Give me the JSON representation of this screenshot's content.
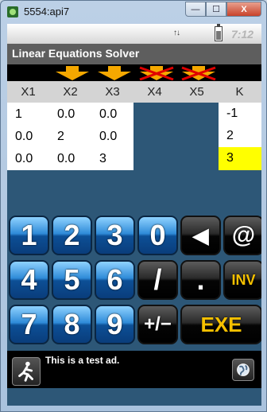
{
  "window": {
    "title": "5554:api7",
    "min_label": "—",
    "max_label": "☐",
    "close_label": "X"
  },
  "status": {
    "signal": "↑↓",
    "clock": "7:12"
  },
  "app": {
    "title": "Linear Equations Solver"
  },
  "headers": [
    "X1",
    "X2",
    "X3",
    "X4",
    "X5",
    "K"
  ],
  "matrix": [
    [
      "1",
      "0.0",
      "0.0"
    ],
    [
      "0.0",
      "2",
      "0.0"
    ],
    [
      "0.0",
      "0.0",
      "3"
    ]
  ],
  "k_values": [
    "-1",
    "2",
    "3"
  ],
  "selected_k_row": 2,
  "arrows": {
    "active_color": "#f5a800",
    "disabled_color": "#e00000"
  },
  "keys": {
    "k1": "1",
    "k2": "2",
    "k3": "3",
    "k0": "0",
    "back": "◀",
    "at": "@",
    "k4": "4",
    "k5": "5",
    "k6": "6",
    "slash": "/",
    "dot": ".",
    "inv": "INV",
    "k7": "7",
    "k8": "8",
    "k9": "9",
    "plusminus": "+/−",
    "exe": "EXE"
  },
  "ad": {
    "text": "This is a test ad."
  }
}
